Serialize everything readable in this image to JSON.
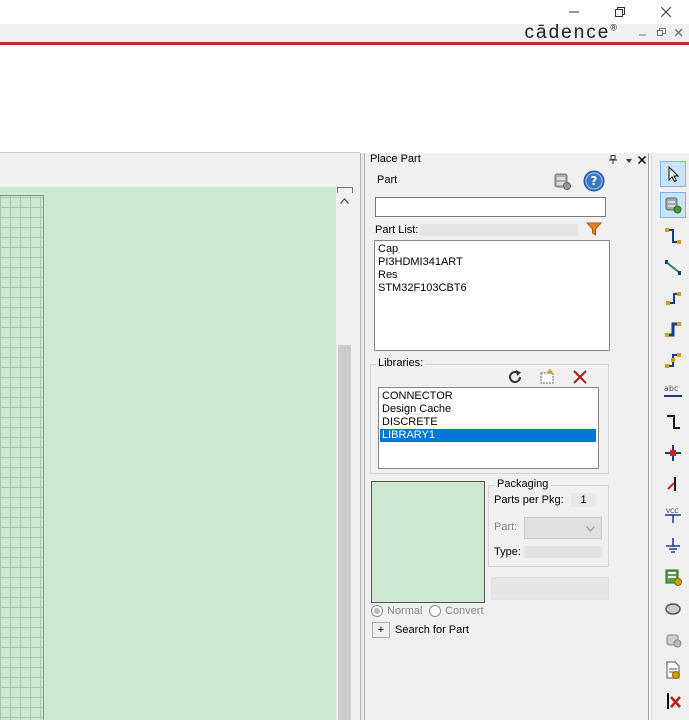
{
  "window": {
    "minimize_icon": "minimize-icon",
    "restore_icon": "restore-icon",
    "close_icon": "close-icon"
  },
  "brand": {
    "logo_text": "cādence",
    "reg_mark": "®"
  },
  "place_part": {
    "title": "Place Part",
    "part_label": "Part",
    "part_value": "",
    "part_list_label": "Part List:",
    "part_list": [
      "Cap",
      "PI3HDMI341ART",
      "Res",
      "STM32F103CBT6"
    ],
    "libraries_label": "Libraries:",
    "libraries": [
      "CONNECTOR",
      "Design Cache",
      "DISCRETE",
      "LIBRARY1"
    ],
    "selected_library": "LIBRARY1",
    "packaging_label": "Packaging",
    "parts_per_pkg_label": "Parts per Pkg:",
    "parts_per_pkg_value": "1",
    "part_select_label": "Part:",
    "type_label": "Type:",
    "type_value": "",
    "normal_label": "Normal",
    "convert_label": "Convert",
    "search_expand": "+",
    "search_label": "Search for Part"
  },
  "colors": {
    "accent_red": "#c1272d",
    "canvas_green": "#cce8d0",
    "selection_blue": "#0078d7"
  }
}
